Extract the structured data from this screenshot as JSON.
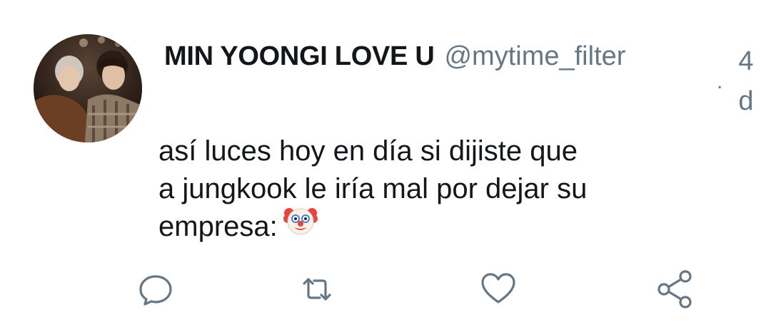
{
  "tweet": {
    "display_name": "MIN YOONGI LOVE U",
    "handle": "@mytime_filter",
    "separator": ".",
    "time": "4d",
    "text_lines": [
      "así luces hoy en día si dijiste que",
      "a jungkook le iría mal por dejar su",
      "empresa:"
    ],
    "emoji": "clown-face"
  },
  "actions": [
    "reply-icon",
    "retweet-icon",
    "like-icon",
    "share-icon"
  ],
  "colors": {
    "text": "#14171a",
    "secondary": "#657786"
  }
}
